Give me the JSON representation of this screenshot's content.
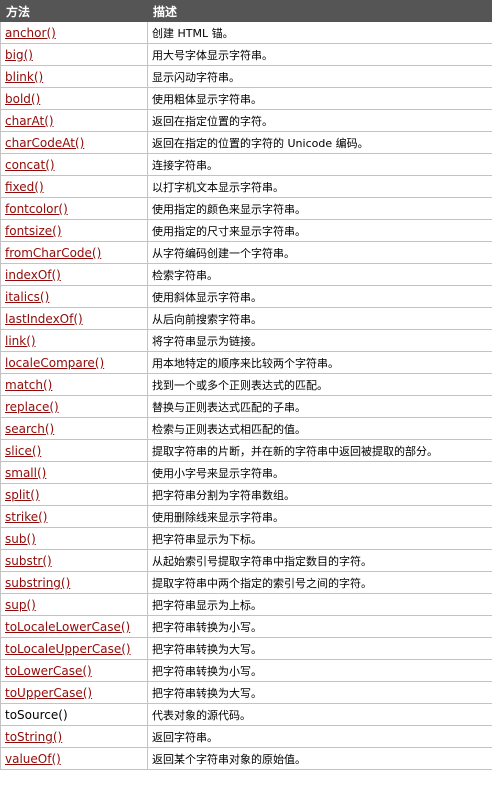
{
  "header": {
    "method": "方法",
    "description": "描述"
  },
  "rows": [
    {
      "method": "anchor()",
      "link": true,
      "description": "创建 HTML 锚。"
    },
    {
      "method": "big()",
      "link": true,
      "description": "用大号字体显示字符串。"
    },
    {
      "method": "blink()",
      "link": true,
      "description": "显示闪动字符串。"
    },
    {
      "method": "bold()",
      "link": true,
      "description": "使用粗体显示字符串。"
    },
    {
      "method": "charAt()",
      "link": true,
      "description": "返回在指定位置的字符。"
    },
    {
      "method": "charCodeAt()",
      "link": true,
      "description": "返回在指定的位置的字符的 Unicode 编码。"
    },
    {
      "method": "concat()",
      "link": true,
      "description": "连接字符串。"
    },
    {
      "method": "fixed()",
      "link": true,
      "description": "以打字机文本显示字符串。"
    },
    {
      "method": "fontcolor()",
      "link": true,
      "description": "使用指定的颜色来显示字符串。"
    },
    {
      "method": "fontsize()",
      "link": true,
      "description": "使用指定的尺寸来显示字符串。"
    },
    {
      "method": "fromCharCode()",
      "link": true,
      "description": "从字符编码创建一个字符串。"
    },
    {
      "method": "indexOf()",
      "link": true,
      "description": "检索字符串。"
    },
    {
      "method": "italics()",
      "link": true,
      "description": "使用斜体显示字符串。"
    },
    {
      "method": "lastIndexOf()",
      "link": true,
      "description": "从后向前搜索字符串。"
    },
    {
      "method": "link()",
      "link": true,
      "description": "将字符串显示为链接。"
    },
    {
      "method": "localeCompare()",
      "link": true,
      "description": "用本地特定的顺序来比较两个字符串。"
    },
    {
      "method": "match()",
      "link": true,
      "description": "找到一个或多个正则表达式的匹配。"
    },
    {
      "method": "replace()",
      "link": true,
      "description": "替换与正则表达式匹配的子串。"
    },
    {
      "method": "search()",
      "link": true,
      "description": "检索与正则表达式相匹配的值。"
    },
    {
      "method": "slice()",
      "link": true,
      "description": "提取字符串的片断，并在新的字符串中返回被提取的部分。"
    },
    {
      "method": "small()",
      "link": true,
      "description": "使用小字号来显示字符串。"
    },
    {
      "method": "split()",
      "link": true,
      "description": "把字符串分割为字符串数组。"
    },
    {
      "method": "strike()",
      "link": true,
      "description": "使用删除线来显示字符串。"
    },
    {
      "method": "sub()",
      "link": true,
      "description": "把字符串显示为下标。"
    },
    {
      "method": "substr()",
      "link": true,
      "description": "从起始索引号提取字符串中指定数目的字符。"
    },
    {
      "method": "substring()",
      "link": true,
      "description": "提取字符串中两个指定的索引号之间的字符。"
    },
    {
      "method": "sup()",
      "link": true,
      "description": "把字符串显示为上标。"
    },
    {
      "method": "toLocaleLowerCase()",
      "link": true,
      "description": "把字符串转换为小写。"
    },
    {
      "method": "toLocaleUpperCase()",
      "link": true,
      "description": "把字符串转换为大写。"
    },
    {
      "method": "toLowerCase()",
      "link": true,
      "description": "把字符串转换为小写。"
    },
    {
      "method": "toUpperCase()",
      "link": true,
      "description": "把字符串转换为大写。"
    },
    {
      "method": "toSource()",
      "link": false,
      "description": "代表对象的源代码。"
    },
    {
      "method": "toString()",
      "link": true,
      "description": "返回字符串。"
    },
    {
      "method": "valueOf()",
      "link": true,
      "description": "返回某个字符串对象的原始值。"
    }
  ]
}
